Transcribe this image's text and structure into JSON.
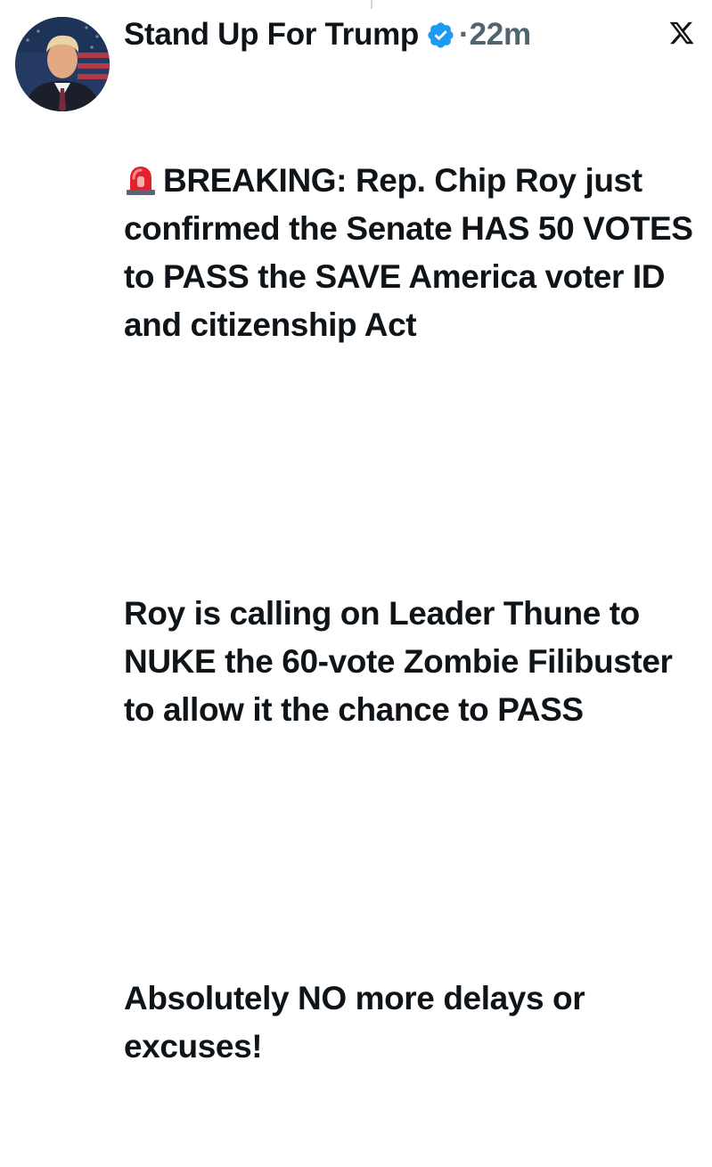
{
  "post": {
    "author": {
      "display_name": "Stand Up For Trump",
      "verified": true,
      "avatar_icon": "avatar-photo"
    },
    "separator": "·",
    "timestamp": "22m",
    "platform_icon": "x-logo-icon",
    "badge_color": "#1d9bf0",
    "siren_icon": "police-siren-emoji",
    "paragraphs": [
      "BREAKING: Rep. Chip Roy just confirmed the Senate HAS 50 VOTES to PASS the SAVE America voter ID and citizenship Act",
      "Roy is calling on Leader Thune to NUKE the 60-vote Zombie Filibuster to allow it the chance to PASS",
      "Absolutely NO more delays or excuses!"
    ]
  }
}
